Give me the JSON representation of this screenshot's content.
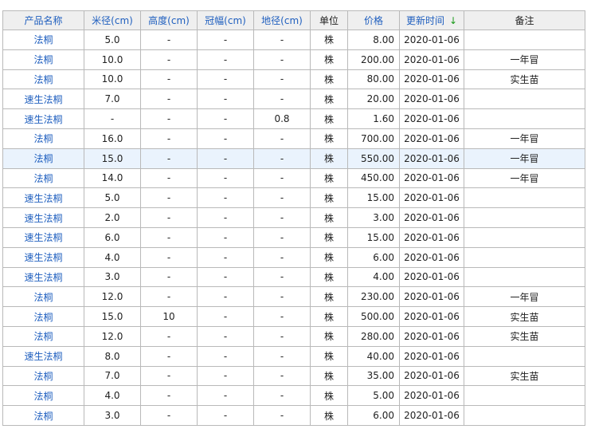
{
  "columns": [
    {
      "label": "产品名称",
      "sortable": true
    },
    {
      "label": "米径(cm)",
      "sortable": true
    },
    {
      "label": "高度(cm)",
      "sortable": true
    },
    {
      "label": "冠幅(cm)",
      "sortable": true
    },
    {
      "label": "地径(cm)",
      "sortable": true
    },
    {
      "label": "单位",
      "sortable": false
    },
    {
      "label": "价格",
      "sortable": true
    },
    {
      "label": "更新时间",
      "sortable": true,
      "sort_icon": "arrow-down-icon"
    },
    {
      "label": "备注",
      "sortable": false
    }
  ],
  "sort_arrow": "↓",
  "colors": {
    "link": "#1f5fbf",
    "sort_arrow": "#1a9a1a",
    "header_bg": "#efefef",
    "highlight_row": "#eaf3fd",
    "border": "#b9b9b9"
  },
  "highlighted_row": 6,
  "rows": [
    {
      "name": "法桐",
      "mi": "5.0",
      "height": "-",
      "crown": "-",
      "ground": "-",
      "unit": "株",
      "price": "8.00",
      "date": "2020-01-06",
      "note": ""
    },
    {
      "name": "法桐",
      "mi": "10.0",
      "height": "-",
      "crown": "-",
      "ground": "-",
      "unit": "株",
      "price": "200.00",
      "date": "2020-01-06",
      "note": "一年冒"
    },
    {
      "name": "法桐",
      "mi": "10.0",
      "height": "-",
      "crown": "-",
      "ground": "-",
      "unit": "株",
      "price": "80.00",
      "date": "2020-01-06",
      "note": "实生苗"
    },
    {
      "name": "速生法桐",
      "mi": "7.0",
      "height": "-",
      "crown": "-",
      "ground": "-",
      "unit": "株",
      "price": "20.00",
      "date": "2020-01-06",
      "note": ""
    },
    {
      "name": "速生法桐",
      "mi": "-",
      "height": "-",
      "crown": "-",
      "ground": "0.8",
      "unit": "株",
      "price": "1.60",
      "date": "2020-01-06",
      "note": ""
    },
    {
      "name": "法桐",
      "mi": "16.0",
      "height": "-",
      "crown": "-",
      "ground": "-",
      "unit": "株",
      "price": "700.00",
      "date": "2020-01-06",
      "note": "一年冒"
    },
    {
      "name": "法桐",
      "mi": "15.0",
      "height": "-",
      "crown": "-",
      "ground": "-",
      "unit": "株",
      "price": "550.00",
      "date": "2020-01-06",
      "note": "一年冒"
    },
    {
      "name": "法桐",
      "mi": "14.0",
      "height": "-",
      "crown": "-",
      "ground": "-",
      "unit": "株",
      "price": "450.00",
      "date": "2020-01-06",
      "note": "一年冒"
    },
    {
      "name": "速生法桐",
      "mi": "5.0",
      "height": "-",
      "crown": "-",
      "ground": "-",
      "unit": "株",
      "price": "15.00",
      "date": "2020-01-06",
      "note": ""
    },
    {
      "name": "速生法桐",
      "mi": "2.0",
      "height": "-",
      "crown": "-",
      "ground": "-",
      "unit": "株",
      "price": "3.00",
      "date": "2020-01-06",
      "note": ""
    },
    {
      "name": "速生法桐",
      "mi": "6.0",
      "height": "-",
      "crown": "-",
      "ground": "-",
      "unit": "株",
      "price": "15.00",
      "date": "2020-01-06",
      "note": ""
    },
    {
      "name": "速生法桐",
      "mi": "4.0",
      "height": "-",
      "crown": "-",
      "ground": "-",
      "unit": "株",
      "price": "6.00",
      "date": "2020-01-06",
      "note": ""
    },
    {
      "name": "速生法桐",
      "mi": "3.0",
      "height": "-",
      "crown": "-",
      "ground": "-",
      "unit": "株",
      "price": "4.00",
      "date": "2020-01-06",
      "note": ""
    },
    {
      "name": "法桐",
      "mi": "12.0",
      "height": "-",
      "crown": "-",
      "ground": "-",
      "unit": "株",
      "price": "230.00",
      "date": "2020-01-06",
      "note": "一年冒"
    },
    {
      "name": "法桐",
      "mi": "15.0",
      "height": "10",
      "crown": "-",
      "ground": "-",
      "unit": "株",
      "price": "500.00",
      "date": "2020-01-06",
      "note": "实生苗"
    },
    {
      "name": "法桐",
      "mi": "12.0",
      "height": "-",
      "crown": "-",
      "ground": "-",
      "unit": "株",
      "price": "280.00",
      "date": "2020-01-06",
      "note": "实生苗"
    },
    {
      "name": "速生法桐",
      "mi": "8.0",
      "height": "-",
      "crown": "-",
      "ground": "-",
      "unit": "株",
      "price": "40.00",
      "date": "2020-01-06",
      "note": ""
    },
    {
      "name": "法桐",
      "mi": "7.0",
      "height": "-",
      "crown": "-",
      "ground": "-",
      "unit": "株",
      "price": "35.00",
      "date": "2020-01-06",
      "note": "实生苗"
    },
    {
      "name": "法桐",
      "mi": "4.0",
      "height": "-",
      "crown": "-",
      "ground": "-",
      "unit": "株",
      "price": "5.00",
      "date": "2020-01-06",
      "note": ""
    },
    {
      "name": "法桐",
      "mi": "3.0",
      "height": "-",
      "crown": "-",
      "ground": "-",
      "unit": "株",
      "price": "6.00",
      "date": "2020-01-06",
      "note": ""
    }
  ]
}
